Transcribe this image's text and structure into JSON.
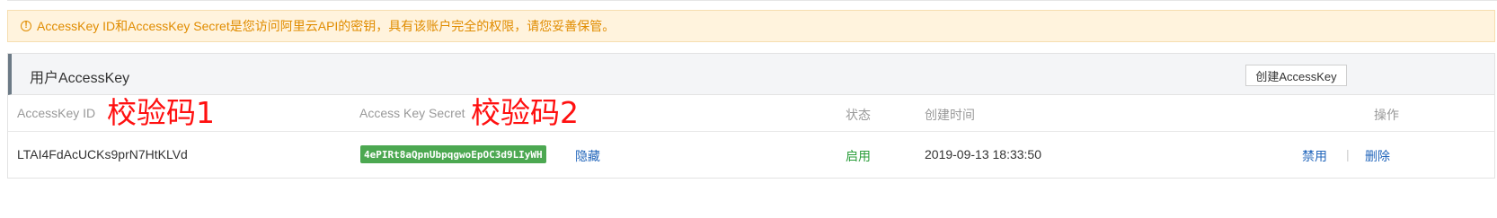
{
  "alert": {
    "icon": "exclamation-circle-icon",
    "text": "AccessKey ID和AccessKey Secret是您访问阿里云API的密钥，具有该账户完全的权限，请您妥善保管。"
  },
  "panel": {
    "title": "用户AccessKey",
    "create_button": "创建AccessKey"
  },
  "table": {
    "columns": {
      "id": "AccessKey ID",
      "secret": "Access Key Secret",
      "status": "状态",
      "created": "创建时间",
      "actions": "操作"
    },
    "rows": [
      {
        "id": "LTAI4FdAcUCKs9prN7HtKLVd",
        "secret": "4ePIRt8aQpnUbpqgwoEpOC3d9LIyWH",
        "hide_link": "隐藏",
        "status": "启用",
        "created": "2019-09-13 18:33:50",
        "disable_link": "禁用",
        "separator": "|",
        "delete_link": "删除"
      }
    ]
  },
  "annotations": {
    "label1": "校验码1",
    "label2": "校验码2"
  },
  "colors": {
    "alert_bg": "#fff3dd",
    "alert_text": "#e08c00",
    "secret_badge": "#4ca851",
    "status_enabled": "#2a9d3a",
    "link": "#2266bb",
    "annotation": "#ff1010"
  }
}
